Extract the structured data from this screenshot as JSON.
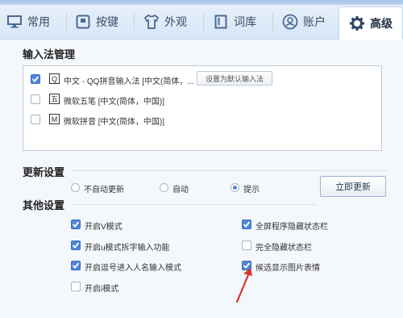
{
  "tabs": [
    {
      "label": "常用",
      "icon": "monitor-icon"
    },
    {
      "label": "按键",
      "icon": "keyboard-icon"
    },
    {
      "label": "外观",
      "icon": "shirt-icon"
    },
    {
      "label": "词库",
      "icon": "book-icon"
    },
    {
      "label": "账户",
      "icon": "user-icon"
    },
    {
      "label": "高级",
      "icon": "gear-icon",
      "active": true
    }
  ],
  "ime_management": {
    "title": "输入法管理",
    "items": [
      {
        "checked": true,
        "icon_char": "Q",
        "text": "中文 - QQ拼音输入法 [中文(简体，...",
        "icon": "qq-pinyin-icon"
      },
      {
        "checked": false,
        "icon_char": "五",
        "text": "微软五笔 [中文(简体，中国)]",
        "icon": "wubi-icon"
      },
      {
        "checked": false,
        "icon_char": "M",
        "text": "微软拼音 [中文(简体，中国)]",
        "icon": "ms-pinyin-icon"
      }
    ],
    "set_default_label": "设置为默认输入法"
  },
  "update_settings": {
    "title": "更新设置",
    "options": [
      {
        "label": "不自动更新",
        "checked": false
      },
      {
        "label": "自动",
        "checked": false
      },
      {
        "label": "提示",
        "checked": true
      }
    ],
    "update_now_label": "立即更新"
  },
  "other_settings": {
    "title": "其他设置",
    "left": [
      {
        "label": "开启V模式",
        "checked": true
      },
      {
        "label": "开启u模式拆字输入功能",
        "checked": true
      },
      {
        "label": "开启逗号进入人名输入模式",
        "checked": true
      },
      {
        "label": "开启i模式",
        "checked": false
      }
    ],
    "right": [
      {
        "label": "全屏程序隐藏状态栏",
        "checked": true
      },
      {
        "label": "完全隐藏状态栏",
        "checked": false
      },
      {
        "label": "候选显示图片表情",
        "checked": true
      }
    ]
  },
  "colors": {
    "accent": "#4f86d9",
    "annotation_arrow": "#d9342b"
  }
}
